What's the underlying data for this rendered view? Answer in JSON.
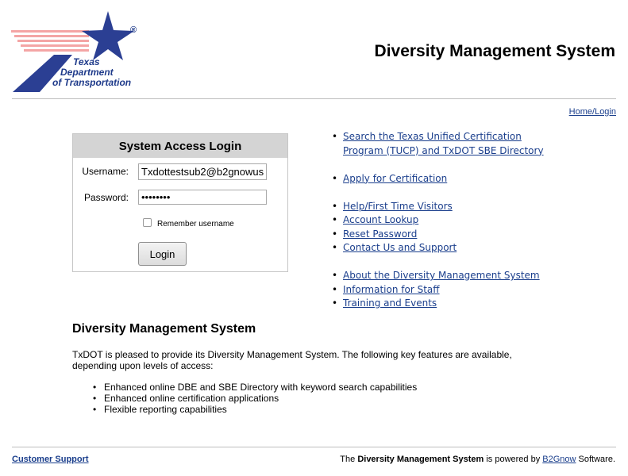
{
  "logo": {
    "icon": "txdot-star-logo",
    "line1": "Texas",
    "line2": "Department",
    "line3": "of Transportation",
    "registered": "®",
    "colors": {
      "star": "#2b3f93",
      "stripes": "#f4a5a5"
    }
  },
  "header": {
    "title": "Diversity Management System"
  },
  "nav": {
    "home_login": "Home/Login"
  },
  "login": {
    "title": "System Access Login",
    "username_label": "Username:",
    "username_value": "Txdottestsub2@b2gnowus",
    "password_label": "Password:",
    "password_value": "••••••••",
    "remember_label": "Remember username",
    "submit_label": "Login"
  },
  "links": {
    "group1": [
      "Search the Texas Unified Certification Program (TUCP) and TxDOT SBE Directory"
    ],
    "group2": [
      "Apply for Certification"
    ],
    "group3": [
      "Help/First Time Visitors",
      "Account Lookup",
      "Reset Password",
      "Contact Us and Support"
    ],
    "group4": [
      "About the Diversity Management System",
      "Information for Staff",
      "Training and Events"
    ]
  },
  "section": {
    "title": "Diversity Management System",
    "description": "TxDOT is pleased to provide its Diversity Management System. The following key features are available, depending upon levels of access:",
    "features": [
      "Enhanced online DBE and SBE Directory with keyword search capabilities",
      "Enhanced online certification applications",
      "Flexible reporting capabilities"
    ]
  },
  "footer": {
    "support": "Customer Support",
    "powered_prefix": "The",
    "powered_system": "Diversity Management System",
    "powered_mid": "is powered by",
    "powered_vendor": "B2Gnow",
    "powered_suffix": "Software."
  }
}
